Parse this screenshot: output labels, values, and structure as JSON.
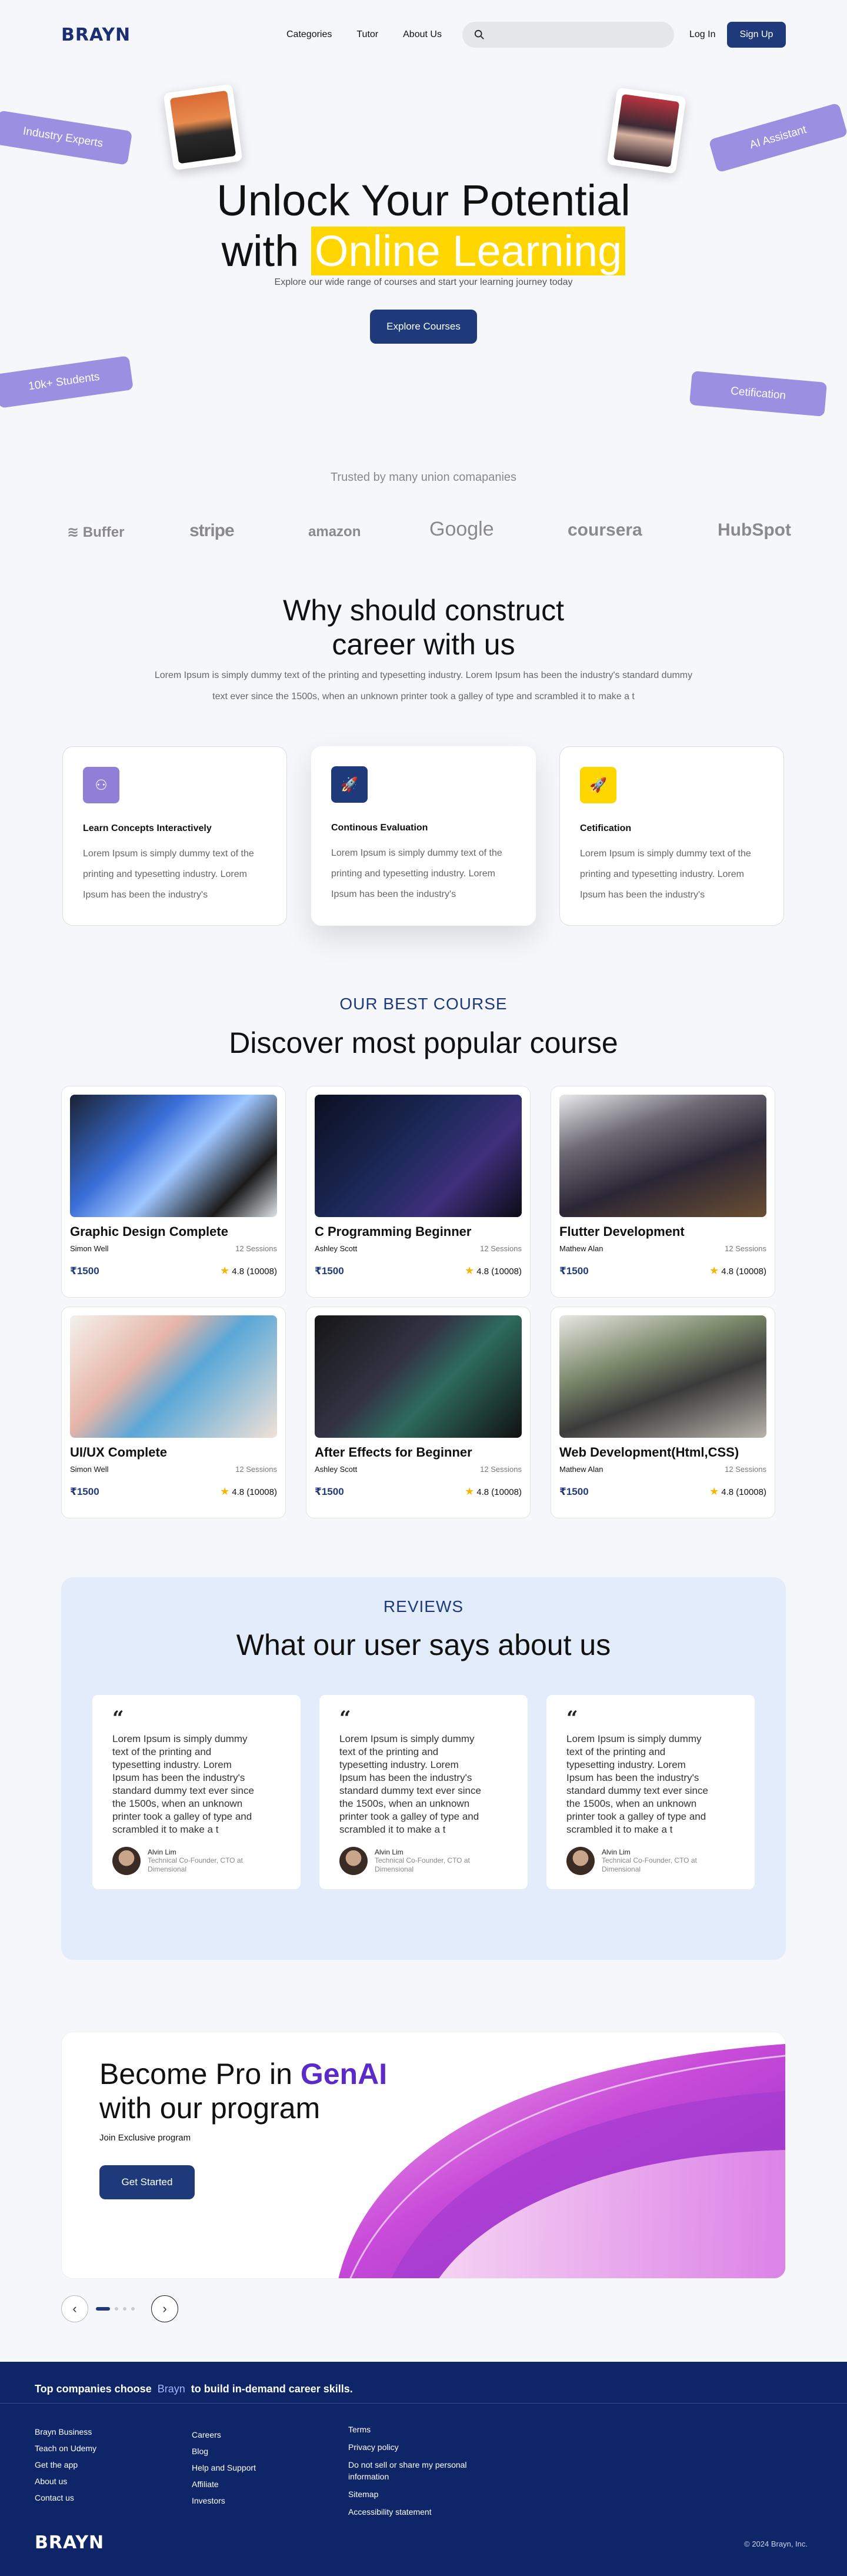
{
  "nav": {
    "logo": "BRAYN",
    "links": [
      "Categories",
      "Tutor",
      "About Us"
    ],
    "search_placeholder": "",
    "login": "Log In",
    "signup": "Sign Up"
  },
  "hero": {
    "tags": [
      "Industry Experts",
      "AI Assistant",
      "10k+ Students",
      "Cetification"
    ],
    "title_line1": "Unlock Your Potential",
    "title_with": "with",
    "title_highlight": "Online Learning",
    "subtitle": "Explore our wide range of courses and start your learning journey today",
    "cta": "Explore Courses"
  },
  "trusted": {
    "heading": "Trusted by many union comapanies",
    "brands": [
      "Buffer",
      "stripe",
      "amazon",
      "Google",
      "coursera",
      "HubSpot"
    ]
  },
  "why": {
    "title_line1": "Why should construct",
    "title_line2": "career with us",
    "text_line1": "Lorem Ipsum is simply dummy text of the printing and typesetting industry. Lorem Ipsum has been the industry's standard dummy",
    "text_line2": "text ever since the 1500s, when an unknown printer took a galley of type and scrambled it to make a t",
    "features": [
      {
        "title": "Learn Concepts Interactively",
        "text": "Lorem Ipsum is simply dummy text of the printing and typesetting industry. Lorem Ipsum has been the industry's",
        "color": "#8f7fd6"
      },
      {
        "title": "Continous Evaluation",
        "text": "Lorem Ipsum is simply dummy text of the printing and typesetting industry. Lorem Ipsum has been the industry's",
        "color": "#1e3a7a"
      },
      {
        "title": "Cetification",
        "text": "Lorem Ipsum is simply dummy text of the printing and typesetting industry. Lorem Ipsum has been the industry's",
        "color": "#ffd600"
      }
    ]
  },
  "courses": {
    "label": "OUR BEST COURSE",
    "title": "Discover most popular course",
    "sessions": "12 Sessions",
    "rating": "4.8 (10008)",
    "items": [
      {
        "title": "Graphic Design Complete",
        "author": "Simon Well",
        "price": "₹1500"
      },
      {
        "title": "C Programming Beginner",
        "author": "Ashley Scott",
        "price": "₹1500"
      },
      {
        "title": "Flutter Development",
        "author": "Mathew Alan",
        "price": "₹1500"
      },
      {
        "title": "UI/UX Complete",
        "author": "Simon Well",
        "price": "₹1500"
      },
      {
        "title": "After Effects for Beginner",
        "author": "Ashley Scott",
        "price": "₹1500"
      },
      {
        "title": "Web Development(Html,CSS)",
        "author": "Mathew Alan",
        "price": "₹1500"
      }
    ]
  },
  "reviews": {
    "label": "REVIEWS",
    "title": "What our user says about us",
    "items": [
      {
        "text": "Lorem Ipsum is simply dummy text of the printing and typesetting industry. Lorem Ipsum has been the industry's standard dummy text ever since the 1500s, when an unknown printer took a galley of type and scrambled it to make a t",
        "name": "Alvin Lim",
        "role": "Technical Co-Founder, CTO at Dimensional"
      },
      {
        "text": "Lorem Ipsum is simply dummy text of the printing and typesetting industry. Lorem Ipsum has been the industry's standard dummy text ever since the 1500s, when an unknown printer took a galley of type and scrambled it to make a t",
        "name": "Alvin Lim",
        "role": "Technical Co-Founder, CTO at Dimensional"
      },
      {
        "text": "Lorem Ipsum is simply dummy text of the printing and typesetting industry. Lorem Ipsum has been the industry's standard dummy text ever since the 1500s, when an unknown printer took a galley of type and scrambled it to make a t",
        "name": "Alvin Lim",
        "role": "Technical Co-Founder, CTO at Dimensional"
      }
    ]
  },
  "promo": {
    "title_prefix": "Become Pro in",
    "title_accent": "GenAI",
    "title_line2": "with our program",
    "sub": "Join Exclusive program",
    "cta": "Get Started"
  },
  "footer": {
    "top_prefix": "Top companies choose",
    "top_brand": "Brayn",
    "top_suffix": "to build in-demand career skills.",
    "col1": [
      "Brayn Business",
      "Teach on Udemy",
      "Get the app",
      "About us",
      "Contact us"
    ],
    "col2": [
      "Careers",
      "Blog",
      "Help and Support",
      "Affiliate",
      "Investors"
    ],
    "col3": [
      "Terms",
      "Privacy policy",
      "Do not sell or share my personal information",
      "Sitemap",
      "Accessibility statement"
    ],
    "logo": "BRAYN",
    "copyright": "© 2024 Brayn, Inc."
  }
}
